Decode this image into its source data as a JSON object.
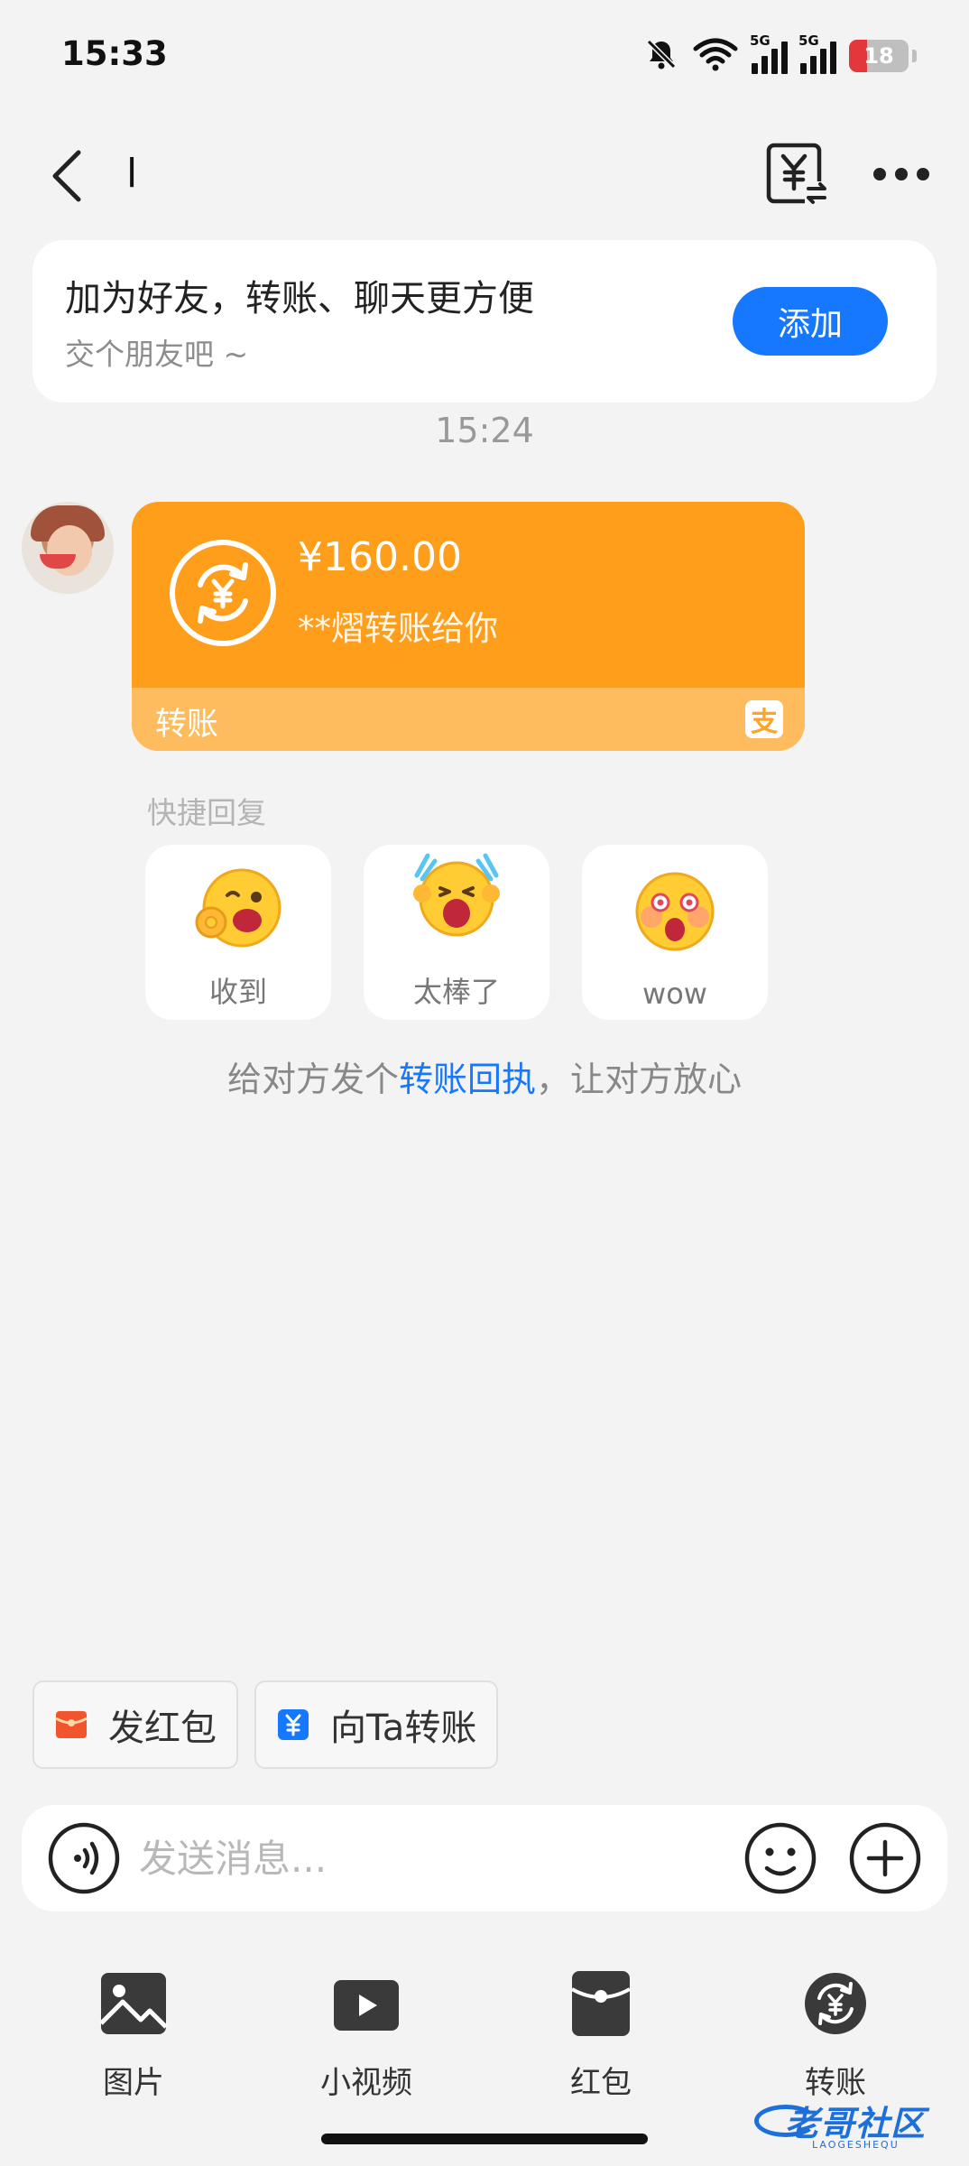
{
  "status_bar": {
    "time": "15:33",
    "network_label_1": "5G",
    "network_label_2": "5G",
    "battery": "18",
    "battery_color": "#e2383b"
  },
  "nav": {
    "title": "l"
  },
  "friend_card": {
    "title": "加为好友，转账、聊天更方便",
    "subtitle": "交个朋友吧 ~",
    "add_label": "添加",
    "accent": "#1677ff"
  },
  "chat": {
    "timestamp": "15:24",
    "transfer": {
      "amount": "¥160.00",
      "description": "**熠转账给你",
      "footer_label": "转账",
      "brand_icon": "支",
      "color": "#ff9e1b"
    },
    "quick_reply_title": "快捷回复",
    "quick_replies": [
      {
        "label": "收到",
        "icon": "ok-hand-wink-emoji"
      },
      {
        "label": "太棒了",
        "icon": "cheering-emoji"
      },
      {
        "label": "wow",
        "icon": "amazed-emoji"
      }
    ],
    "receipt_tip": {
      "before": "给对方发个",
      "link": "转账回执",
      "after": "，让对方放心"
    }
  },
  "shortcuts": [
    {
      "label": "发红包",
      "icon": "red-packet-icon",
      "color": "#f2542d"
    },
    {
      "label": "向Ta转账",
      "icon": "transfer-yuan-icon",
      "color": "#1677ff"
    }
  ],
  "input": {
    "placeholder": "发送消息..."
  },
  "toolbar": [
    {
      "label": "图片",
      "icon": "image-icon"
    },
    {
      "label": "小视频",
      "icon": "video-icon"
    },
    {
      "label": "红包",
      "icon": "red-packet-icon"
    },
    {
      "label": "转账",
      "icon": "transfer-icon"
    }
  ],
  "watermark": {
    "text": "老哥社区",
    "sub": "LAOGESHEQU"
  }
}
